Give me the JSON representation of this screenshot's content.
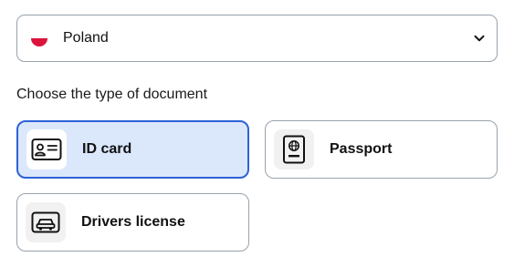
{
  "country_select": {
    "selected": "Poland",
    "flag_icon": "poland-flag-icon",
    "chevron_icon": "chevron-down-icon"
  },
  "section_title": "Choose the type of document",
  "documents": [
    {
      "label": "ID card",
      "icon": "id-card-icon",
      "selected": true
    },
    {
      "label": "Passport",
      "icon": "passport-icon",
      "selected": false
    },
    {
      "label": "Drivers license",
      "icon": "car-icon",
      "selected": false
    }
  ],
  "colors": {
    "selected_border": "#2d62d8",
    "selected_background": "#dbe7fb",
    "border": "#98a2ad",
    "poland_red": "#dc143c"
  }
}
